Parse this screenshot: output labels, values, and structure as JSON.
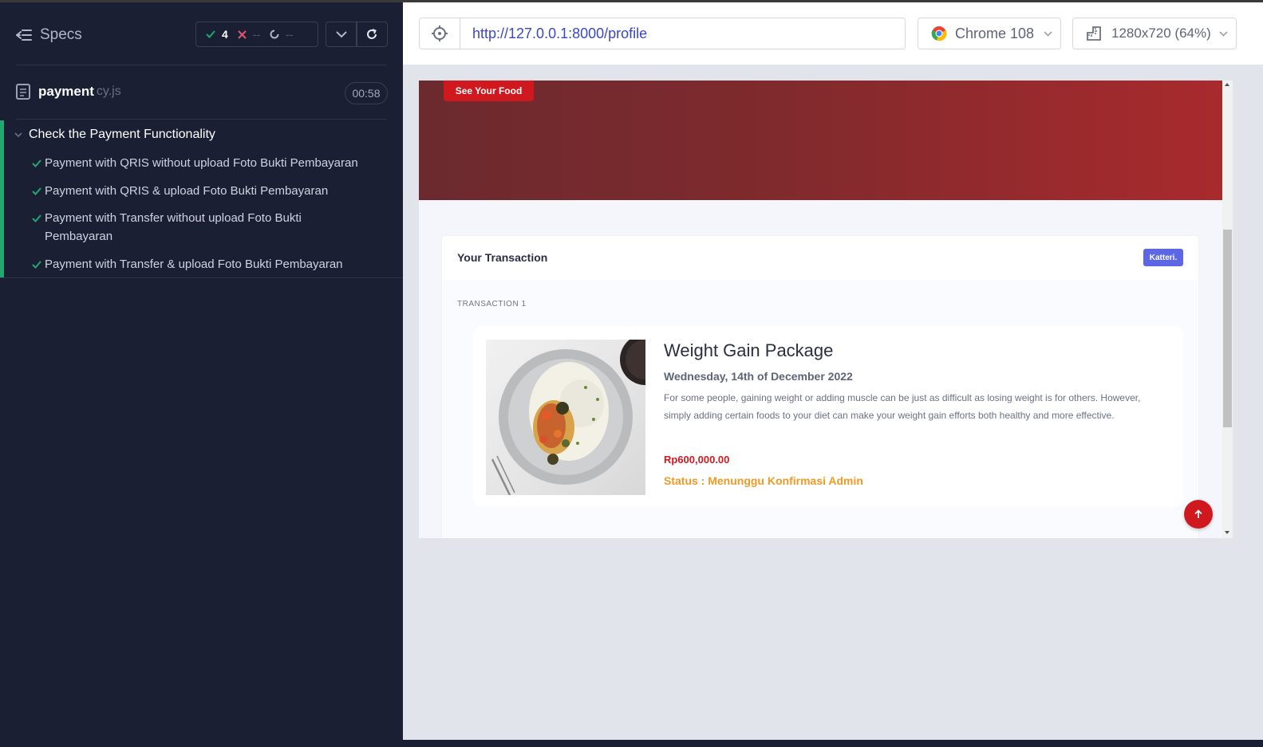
{
  "sidebar": {
    "header_label": "Specs",
    "stats": {
      "passed": "4",
      "failed": "--",
      "pending": "--"
    },
    "file": {
      "name": "payment",
      "ext": "cy.js",
      "duration": "00:58"
    },
    "suite_title": "Check the Payment Functionality",
    "tests": [
      {
        "label": "Payment with QRIS without upload Foto Bukti Pembayaran",
        "status": "passed"
      },
      {
        "label": "Payment with QRIS & upload Foto Bukti Pembayaran",
        "status": "passed"
      },
      {
        "label": "Payment with Transfer without upload Foto Bukti Pembayaran",
        "status": "passed"
      },
      {
        "label": "Payment with Transfer & upload Foto Bukti Pembayaran",
        "status": "passed"
      }
    ]
  },
  "urlbar": {
    "url": "http://127.0.0.1:8000/profile",
    "browser": "Chrome 108",
    "viewport": "1280x720 (64%)"
  },
  "app": {
    "hero_button": "See Your Food",
    "card_title": "Your Transaction",
    "badge": "Katteri.",
    "transaction_label": "TRANSACTION 1",
    "package": {
      "title": "Weight Gain Package",
      "date": "Wednesday, 14th of December 2022",
      "description": "For some people, gaining weight or adding muscle can be just as difficult as losing weight is for others. However, simply adding certain foods to your diet can make your weight gain efforts both healthy and more effective.",
      "price": "Rp600,000.00",
      "status": "Status : Menunggu Konfirmasi Admin"
    }
  },
  "colors": {
    "sidebar_bg": "#1b1f33",
    "pass_green": "#1fa971",
    "fail_red": "#e45770",
    "brand_red": "#d0191e",
    "status_orange": "#f09a25",
    "badge_purple": "#5e67e3",
    "url_blue": "#3c47c4"
  }
}
